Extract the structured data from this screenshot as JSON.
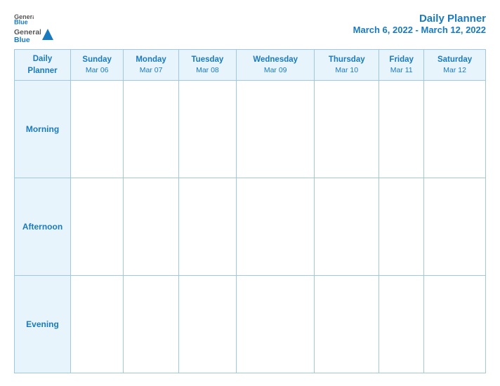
{
  "header": {
    "logo_general": "General",
    "logo_blue": "Blue",
    "title": "Daily Planner",
    "subtitle": "March 6, 2022 - March 12, 2022"
  },
  "table": {
    "columns": [
      {
        "id": "planner",
        "day": "Daily",
        "day2": "Planner",
        "date": ""
      },
      {
        "id": "sunday",
        "day": "Sunday",
        "day2": "",
        "date": "Mar 06"
      },
      {
        "id": "monday",
        "day": "Monday",
        "day2": "",
        "date": "Mar 07"
      },
      {
        "id": "tuesday",
        "day": "Tuesday",
        "day2": "",
        "date": "Mar 08"
      },
      {
        "id": "wednesday",
        "day": "Wednesday",
        "day2": "",
        "date": "Mar 09"
      },
      {
        "id": "thursday",
        "day": "Thursday",
        "day2": "",
        "date": "Mar 10"
      },
      {
        "id": "friday",
        "day": "Friday",
        "day2": "",
        "date": "Mar 11"
      },
      {
        "id": "saturday",
        "day": "Saturday",
        "day2": "",
        "date": "Mar 12"
      }
    ],
    "rows": [
      {
        "label": "Morning"
      },
      {
        "label": "Afternoon"
      },
      {
        "label": "Evening"
      }
    ]
  }
}
